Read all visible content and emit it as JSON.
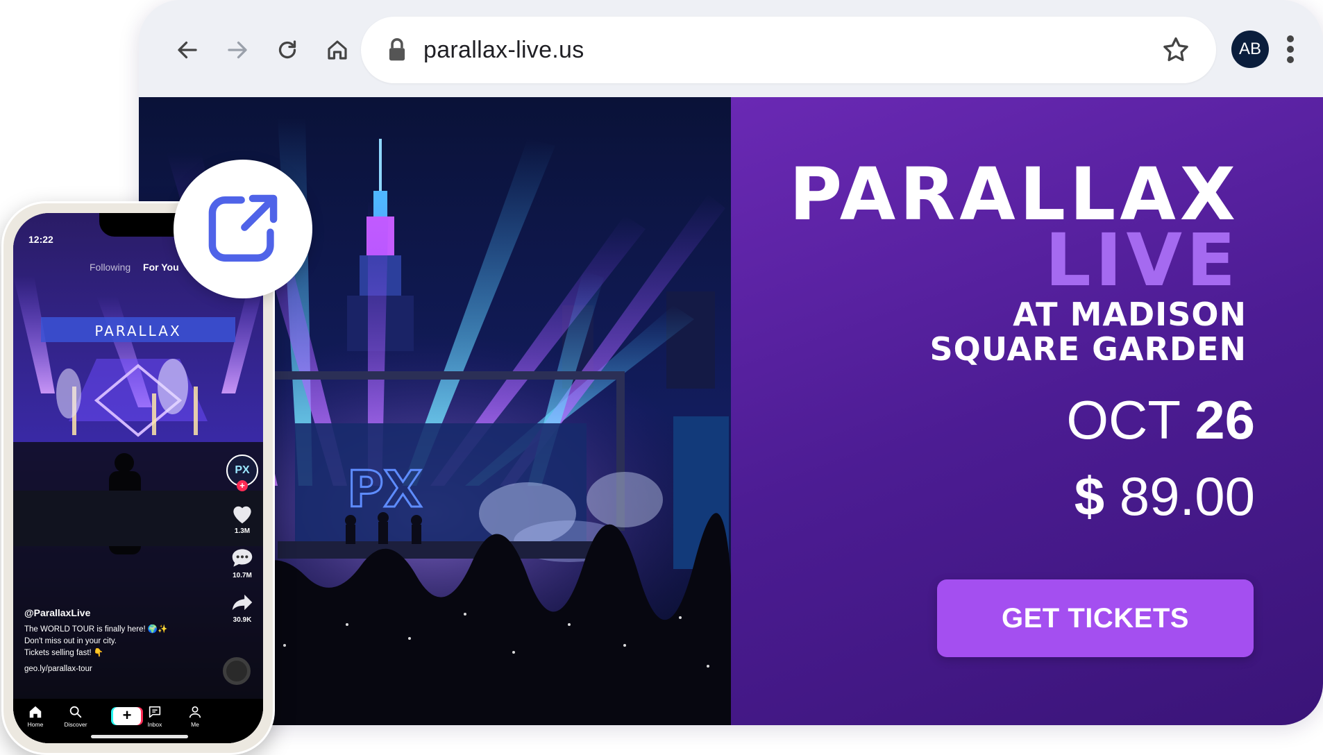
{
  "browser": {
    "url": "parallax-live.us",
    "avatar_initials": "AB",
    "toolbar_icons": [
      "back-arrow-icon",
      "forward-arrow-icon",
      "reload-icon",
      "home-icon",
      "lock-icon",
      "bookmark-star-icon",
      "more-menu-icon"
    ]
  },
  "hero": {
    "title": "PARALLAX",
    "subtitle": "LIVE",
    "venue_line1": "AT MADISON",
    "venue_line2": "SQUARE GARDEN",
    "month": "OCT",
    "day": "26",
    "currency": "$",
    "price": "89.00",
    "cta_label": "GET TICKETS",
    "screen_logo": "PX",
    "colors": {
      "promo_bg": "#5b22a6",
      "subtitle_accent": "#a56af0",
      "cta": "#a44ff0"
    }
  },
  "phone": {
    "time": "12:22",
    "tabs": [
      "Following",
      "For You"
    ],
    "banner_text": "PARALLAX",
    "avatar_text": "PX",
    "likes": "1.3M",
    "comments": "10.7M",
    "shares": "30.9K",
    "handle": "@ParallaxLive",
    "caption_lines": [
      "The WORLD TOUR is finally here! 🌍✨",
      "Don't miss out in your city.",
      "Tickets selling fast! 👇"
    ],
    "link": "geo.ly/parallax-tour",
    "nav": [
      "Home",
      "Discover",
      "+",
      "Inbox",
      "Me"
    ]
  },
  "share": {
    "icon": "share-external-icon",
    "color": "#4f63e8"
  }
}
